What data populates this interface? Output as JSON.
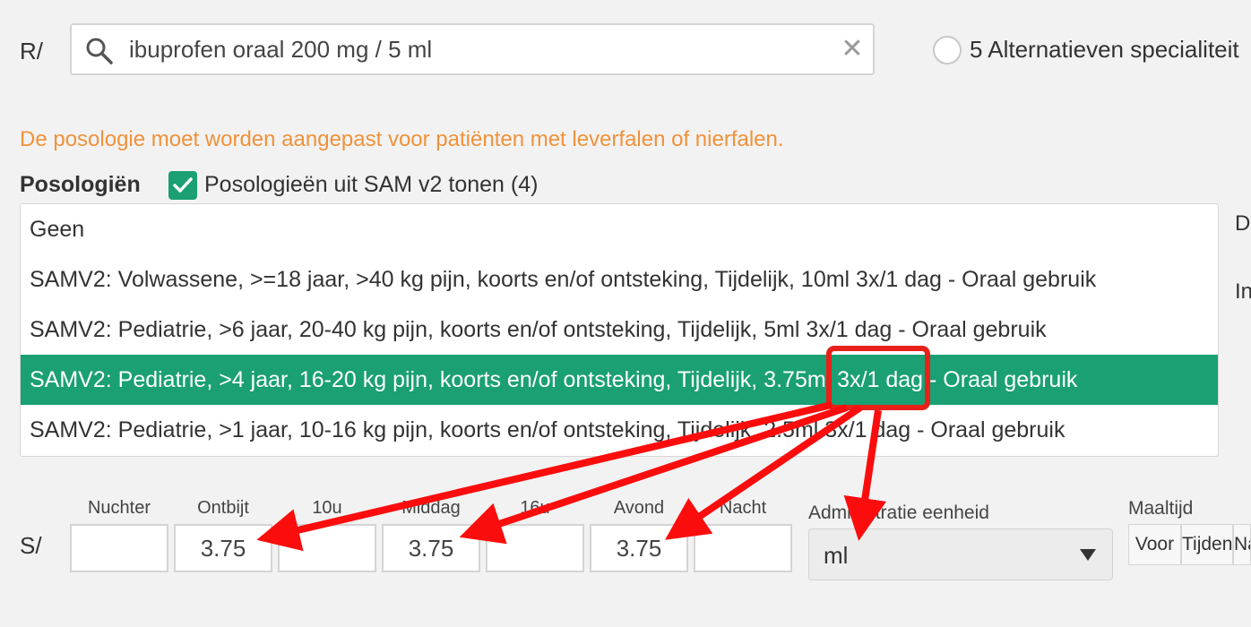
{
  "prescription": {
    "prefix": "R/",
    "search_value": "ibuprofen oraal 200 mg / 5 ml",
    "alternatives_label": "5 Alternatieven specialiteit"
  },
  "warning_text": "De posologie moet worden aangepast voor patiënten met leverfalen of nierfalen.",
  "posologies": {
    "title": "Posologiën",
    "sam_checkbox_label": "Posologieën uit SAM v2 tonen (4)",
    "sam_checkbox_checked": true,
    "items": [
      {
        "label": "Geen",
        "selected": false
      },
      {
        "label": "SAMV2: Volwassene, >=18 jaar, >40 kg pijn, koorts en/of ontsteking, Tijdelijk, 10ml 3x/1 dag - Oraal gebruik",
        "selected": false
      },
      {
        "label": "SAMV2: Pediatrie, >6 jaar, 20-40 kg pijn, koorts en/of ontsteking, Tijdelijk, 5ml 3x/1 dag - Oraal gebruik",
        "selected": false
      },
      {
        "label": "SAMV2: Pediatrie, >4 jaar, 16-20 kg pijn, koorts en/of ontsteking, Tijdelijk, 3.75ml 3x/1 dag - Oraal gebruik",
        "selected": true
      },
      {
        "label": "SAMV2: Pediatrie, >1 jaar, 10-16 kg pijn, koorts en/of ontsteking, Tijdelijk, 2.5ml 3x/1 dag - Oraal gebruik",
        "selected": false
      }
    ],
    "side_labels": [
      "D",
      "In"
    ]
  },
  "schedule": {
    "prefix": "S/",
    "columns": [
      {
        "time": "Nuchter",
        "dose": ""
      },
      {
        "time": "Ontbijt",
        "dose": "3.75"
      },
      {
        "time": "10u",
        "dose": ""
      },
      {
        "time": "Middag",
        "dose": "3.75"
      },
      {
        "time": "16u",
        "dose": ""
      },
      {
        "time": "Avond",
        "dose": "3.75"
      },
      {
        "time": "Nacht",
        "dose": ""
      }
    ],
    "admin_unit_label": "Administratie eenheid",
    "admin_unit_value": "ml",
    "meal_label": "Maaltijd",
    "meal_options": [
      "Voor",
      "Tijdens",
      "Na"
    ]
  },
  "annotation": {
    "highlight_color": "#e8201a",
    "arrow_color": "#fb0d0d"
  }
}
